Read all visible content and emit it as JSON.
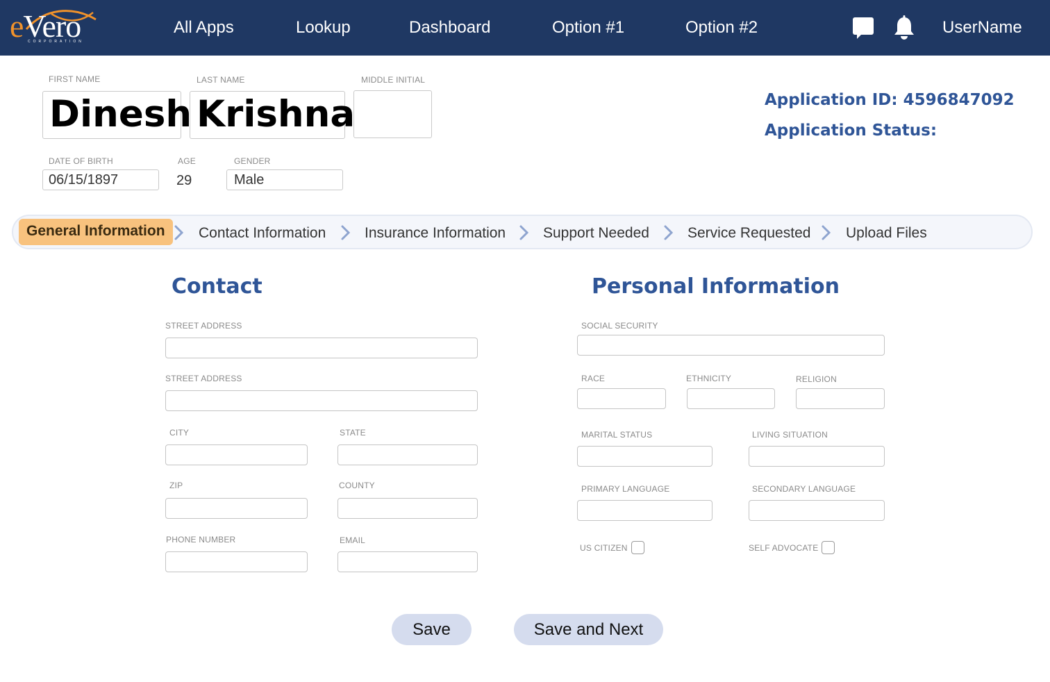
{
  "header": {
    "logo_text": "eVero",
    "logo_sub": "CORPORATION",
    "nav": [
      "All Apps",
      "Lookup",
      "Dashboard",
      "Option #1",
      "Option #2"
    ],
    "username": "UserName",
    "icons": {
      "chat": "chat-icon",
      "bell": "bell-icon"
    },
    "bg_color": "#1f3863"
  },
  "applicant": {
    "first_name_label": "FIRST NAME",
    "first_name": "Dinesh",
    "last_name_label": "LAST NAME",
    "last_name": "Krishna",
    "middle_initial_label": "MIDDLE INITIAL",
    "middle_initial": "",
    "dob_label": "DATE OF BIRTH",
    "dob": "06/15/1897",
    "age_label": "AGE",
    "age": "29",
    "gender_label": "GENDER",
    "gender": "Male"
  },
  "application": {
    "id_text": "Application ID: 4596847092",
    "status_text": "Application Status:"
  },
  "steps": [
    {
      "label": "General Information",
      "active": true
    },
    {
      "label": "Contact Information",
      "active": false
    },
    {
      "label": "Insurance Information",
      "active": false
    },
    {
      "label": "Support Needed",
      "active": false
    },
    {
      "label": "Service Requested",
      "active": false
    },
    {
      "label": "Upload Files",
      "active": false
    }
  ],
  "contact": {
    "title": "Contact",
    "street1_label": "STREET ADDRESS",
    "street2_label": "STREET ADDRESS",
    "city_label": "CITY",
    "state_label": "STATE",
    "zip_label": "ZIP",
    "county_label": "COUNTY",
    "phone_label": "PHONE NUMBER",
    "email_label": "EMAIL"
  },
  "personal": {
    "title": "Personal Information",
    "ssn_label": "SOCIAL SECURITY",
    "race_label": "RACE",
    "ethnicity_label": "ETHNICITY",
    "religion_label": "RELIGION",
    "marital_label": "MARITAL STATUS",
    "living_label": "LIVING SITUATION",
    "primary_lang_label": "PRIMARY LANGUAGE",
    "secondary_lang_label": "SECONDARY LANGUAGE",
    "us_citizen_label": "US CITIZEN",
    "self_advocate_label": "SELF ADVOCATE"
  },
  "buttons": {
    "save": "Save",
    "save_next": "Save and Next"
  },
  "colors": {
    "accent": "#2f5597",
    "active_step": "#f8c27e",
    "button": "#d5dcee",
    "logo_orange": "#f0922b"
  }
}
